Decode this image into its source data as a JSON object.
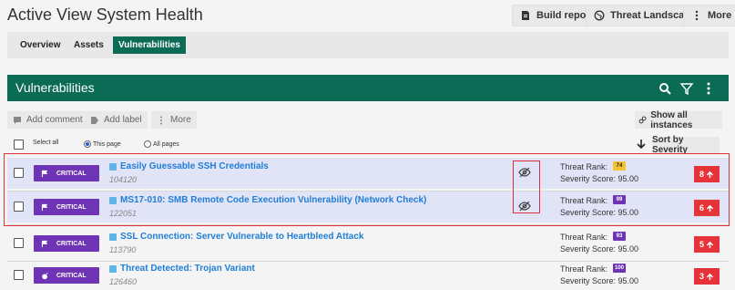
{
  "header": {
    "title": "Active View System Health",
    "buttons": {
      "build_report": "Build report",
      "threat_landscape": "Threat Landscape",
      "more": "More"
    }
  },
  "tabs": [
    {
      "label": "Overview",
      "active": false
    },
    {
      "label": "Assets",
      "active": false
    },
    {
      "label": "Vulnerabilities",
      "active": true
    }
  ],
  "panel": {
    "title": "Vulnerabilities",
    "icons": [
      "search-icon",
      "filter-icon",
      "kebab-icon"
    ]
  },
  "toolbar": {
    "add_comment": "Add comment",
    "add_label": "Add label",
    "more": "More",
    "show_all": "Show all instances",
    "select_all": "Select all",
    "this_page": "This page",
    "all_pages": "All pages",
    "sort": "Sort by Severity"
  },
  "rows": [
    {
      "severity": "CRITICAL",
      "severity_icon": "flag-icon",
      "title": "Easily Guessable SSH Credentials",
      "id": "104120",
      "rank_label": "Threat Rank:",
      "rank": "74",
      "rank_color": "#f4c430",
      "score": "Severity Score: 95.00",
      "count": "8",
      "hidden": true,
      "highlight": true
    },
    {
      "severity": "CRITICAL",
      "severity_icon": "flag-icon",
      "title": "MS17-010: SMB Remote Code Execution Vulnerability (Network Check)",
      "id": "122051",
      "rank_label": "Threat Rank:",
      "rank": "99",
      "rank_color": "#6f33b5",
      "score": "Severity Score: 95.00",
      "count": "6",
      "hidden": true,
      "highlight": true
    },
    {
      "severity": "CRITICAL",
      "severity_icon": "flag-icon",
      "title": "SSL Connection: Server Vulnerable to Heartbleed Attack",
      "id": "113790",
      "rank_label": "Threat Rank:",
      "rank": "93",
      "rank_color": "#6f33b5",
      "score": "Severity Score: 95.00",
      "count": "5",
      "hidden": false,
      "highlight": false
    },
    {
      "severity": "CRITICAL",
      "severity_icon": "bomb-icon",
      "title": "Threat Detected: Trojan Variant",
      "id": "126460",
      "rank_label": "Threat Rank:",
      "rank": "100",
      "rank_color": "#6f33b5",
      "score": "Severity Score: 95.00",
      "count": "3",
      "hidden": false,
      "highlight": false
    }
  ],
  "colors": {
    "brand": "#0b6b55",
    "critical": "#6f33b5",
    "alert": "#e6333a",
    "link": "#1f7ed6"
  }
}
